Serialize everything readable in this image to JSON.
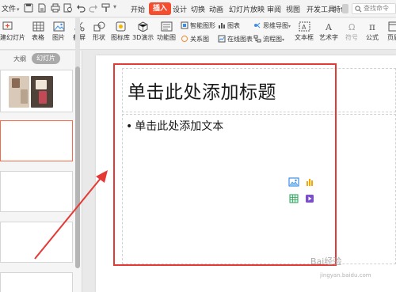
{
  "menubar": {
    "file_label": "文件",
    "tabs": [
      "开始",
      "插入",
      "设计",
      "切换",
      "动画",
      "幻灯片放映",
      "审阅",
      "视图",
      "开发工具",
      "特色"
    ],
    "active_tab": "插入",
    "search_label": "查找命令"
  },
  "ribbon": {
    "new_slide": "新建幻灯片",
    "table": "表格",
    "picture": "图片",
    "screenshot": "截屏",
    "shape": "形状",
    "icon_library": "图标库",
    "demo_3d": "3D演示",
    "function_chart": "功能图",
    "smart_shape": "智能图形",
    "chart": "图表",
    "relation_chart": "关系图",
    "online_chart": "在线图表",
    "mind_map": "思维导图",
    "flowchart": "流程图",
    "textbox": "文本框",
    "art_text": "艺术字",
    "symbol": "符号",
    "formula": "公式",
    "header_footer": "页眉"
  },
  "left_panel": {
    "tab_outline": "大纲",
    "tab_slides": "幻灯片"
  },
  "slide": {
    "title_placeholder": "单击此处添加标题",
    "body_placeholder": "单击此处添加文本",
    "bullet": "•"
  },
  "watermark": {
    "main": "Bai经验",
    "sub": "jingyan.baidu.com"
  },
  "colors": {
    "accent": "#f24e2f",
    "highlight": "#e53935",
    "arrow": "#e53935"
  }
}
